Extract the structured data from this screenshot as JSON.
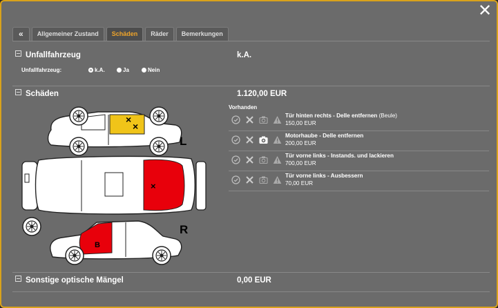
{
  "close_label": "✕",
  "tabs": [
    {
      "label": "«"
    },
    {
      "label": "Allgemeiner Zustand"
    },
    {
      "label": "Schäden"
    },
    {
      "label": "Räder"
    },
    {
      "label": "Bemerkungen"
    }
  ],
  "active_tab": 2,
  "accident": {
    "heading": "Unfallfahrzeug",
    "value": "k.A.",
    "field_label": "Unfallfahrzeug:",
    "options": [
      "k.A.",
      "Ja",
      "Nein"
    ],
    "selected": "k.A."
  },
  "damages": {
    "heading": "Schäden",
    "total": "1.120,00 EUR",
    "list_label": "Vorhanden",
    "side_labels": {
      "left": "L",
      "right": "R"
    },
    "marker_letter": "B",
    "items": [
      {
        "title": "Tür hinten rechts - Delle entfernen",
        "note": "(Beule)",
        "price": "150,00 EUR",
        "has_photo": false
      },
      {
        "title": "Motorhaube - Delle entfernen",
        "note": "",
        "price": "200,00 EUR",
        "has_photo": true
      },
      {
        "title": "Tür vorne links - Instands. und lackieren",
        "note": "",
        "price": "700,00 EUR",
        "has_photo": false
      },
      {
        "title": "Tür vorne links - Ausbessern",
        "note": "",
        "price": "70,00 EUR",
        "has_photo": false
      }
    ]
  },
  "other": {
    "heading": "Sonstige optische Mängel",
    "value": "0,00 EUR"
  },
  "colors": {
    "accent": "#d9a21b",
    "damage_yellow": "#f0c419",
    "damage_red": "#e8000b"
  }
}
